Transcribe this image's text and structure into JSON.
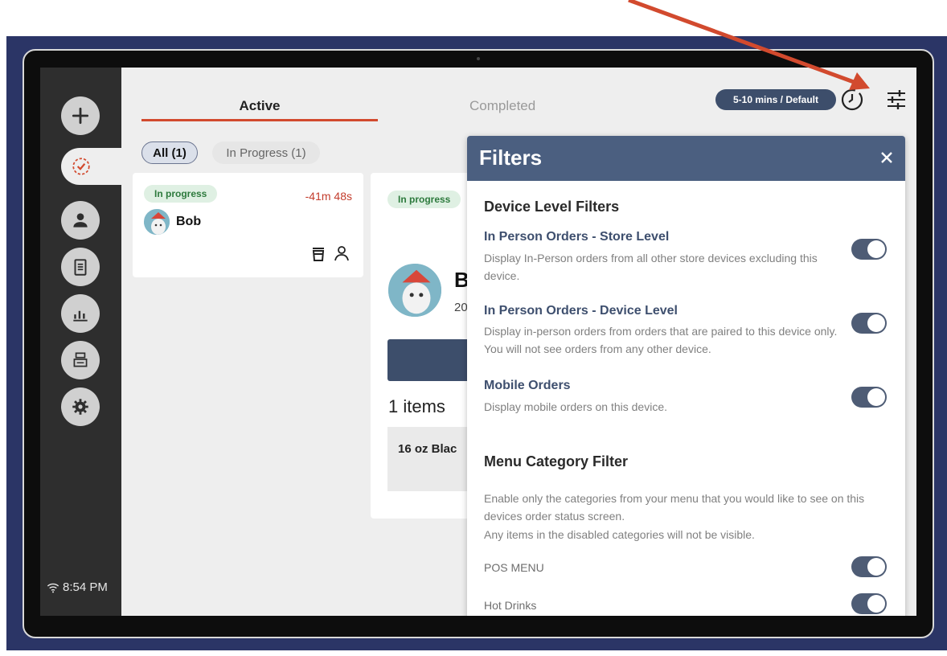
{
  "tabs": {
    "active": "Active",
    "completed": "Completed"
  },
  "header": {
    "time_pill": "5-10 mins / Default"
  },
  "chips": {
    "all": "All (1)",
    "in_progress": "In Progress (1)"
  },
  "order_card": {
    "status": "In progress",
    "timer": "-41m 48s",
    "customer": "Bob"
  },
  "detail": {
    "status": "In progress",
    "name_fragment": "B",
    "date_fragment": "20",
    "items_count": "1 items",
    "item_name": "16 oz Blac"
  },
  "status_bar": {
    "time": "8:54 PM"
  },
  "filters": {
    "title": "Filters",
    "device_section": "Device Level Filters",
    "options": [
      {
        "title": "In Person Orders - Store Level",
        "desc": "Display In-Person orders from all other store devices excluding this device.",
        "enabled": true
      },
      {
        "title": "In Person Orders - Device Level",
        "desc": "Display in-person orders from orders that are paired to this device only. You will not see orders from any other device.",
        "enabled": true
      },
      {
        "title": "Mobile Orders",
        "desc": "Display mobile orders on this device.",
        "enabled": true
      }
    ],
    "menu_section": "Menu Category Filter",
    "menu_desc_1": "Enable only the categories from your menu that you would like to see on this devices order status screen.",
    "menu_desc_2": "Any items in the disabled categories will not be visible.",
    "categories": [
      {
        "label": "POS MENU",
        "enabled": true
      },
      {
        "label": "Hot Drinks",
        "enabled": true
      }
    ]
  },
  "colors": {
    "accent_red": "#d24a2e",
    "navy": "#3d4e6b",
    "header_blue": "#4b5f80",
    "arrow": "#d24a2e"
  }
}
